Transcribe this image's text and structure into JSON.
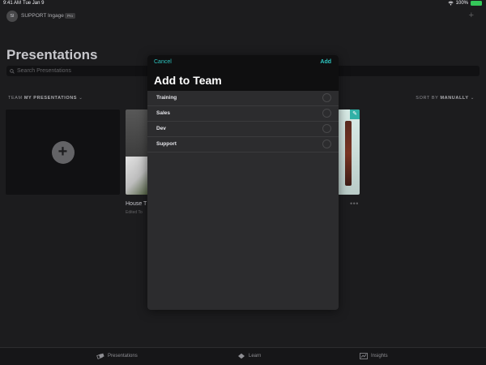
{
  "status_bar": {
    "time": "9:41 AM",
    "date": "Tue Jan 9",
    "battery": "100%",
    "battery_level": 100
  },
  "header": {
    "avatar_initials": "SI",
    "org_name": "SUPPORT Ingage",
    "plan_badge": "Pro"
  },
  "page": {
    "title": "Presentations",
    "search_placeholder": "Search Presentations"
  },
  "filters": {
    "team_label": "TEAM",
    "team_value": "MY PRESENTATIONS",
    "sort_label": "SORT BY",
    "sort_value": "MANUALLY"
  },
  "cards": [
    {
      "title": "House T",
      "subtitle": "Edited To"
    }
  ],
  "modal": {
    "cancel_label": "Cancel",
    "add_label": "Add",
    "title": "Add to Team",
    "teams": [
      {
        "name": "Training",
        "selected": false
      },
      {
        "name": "Sales",
        "selected": false
      },
      {
        "name": "Dev",
        "selected": false
      },
      {
        "name": "Support",
        "selected": false
      }
    ]
  },
  "tab_bar": {
    "items": [
      {
        "label": "Presentations",
        "icon": "presentations-icon"
      },
      {
        "label": "Learn",
        "icon": "learn-icon"
      },
      {
        "label": "Insights",
        "icon": "insights-icon"
      }
    ]
  },
  "colors": {
    "accent": "#2dc5c0",
    "background": "#1c1c1e",
    "modal_background": "#2c2c2e",
    "battery": "#34c759"
  }
}
